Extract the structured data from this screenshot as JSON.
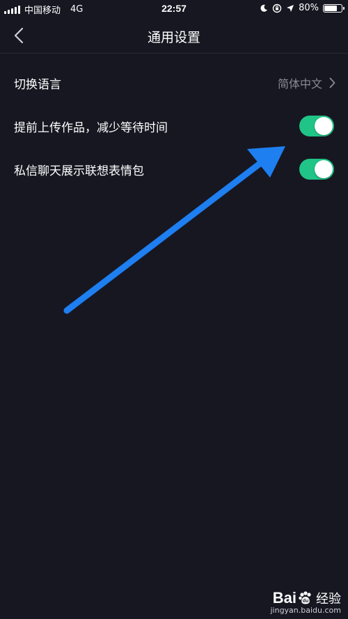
{
  "status_bar": {
    "carrier": "中国移动",
    "network": "4G",
    "time": "22:57",
    "battery_text": "80%",
    "battery_level": 0.8
  },
  "nav": {
    "title": "通用设置",
    "back_icon": "chevron-left-icon"
  },
  "settings": {
    "language": {
      "label": "切换语言",
      "value": "简体中文"
    },
    "pre_upload": {
      "label": "提前上传作品，减少等待时间",
      "enabled": true
    },
    "emoji_suggest": {
      "label": "私信聊天展示联想表情包",
      "enabled": true
    }
  },
  "colors": {
    "background": "#171722",
    "toggle_on": "#20c486",
    "annotation_arrow": "#1e7ff0",
    "secondary_text": "#8a8a95"
  },
  "watermark": {
    "brand": "Bai",
    "brand_suffix": "经验",
    "url": "jingyan.baidu.com"
  }
}
